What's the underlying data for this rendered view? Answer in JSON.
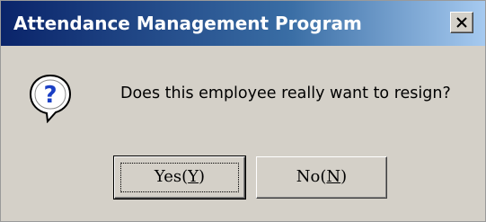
{
  "dialog": {
    "title": "Attendance Management Program",
    "message": "Does this employee really want to resign?",
    "icon": "question-icon",
    "close_icon": "close-icon"
  },
  "buttons": {
    "yes": {
      "text": "Yes(",
      "hotkey": "Y",
      "suffix": ")"
    },
    "no": {
      "text": "No(",
      "hotkey": "N",
      "suffix": ")"
    }
  },
  "colors": {
    "titlebar_start": "#0a246a",
    "titlebar_end": "#a6caf0",
    "dialog_face": "#d4d0c8",
    "icon_blue": "#1a3fc4"
  }
}
